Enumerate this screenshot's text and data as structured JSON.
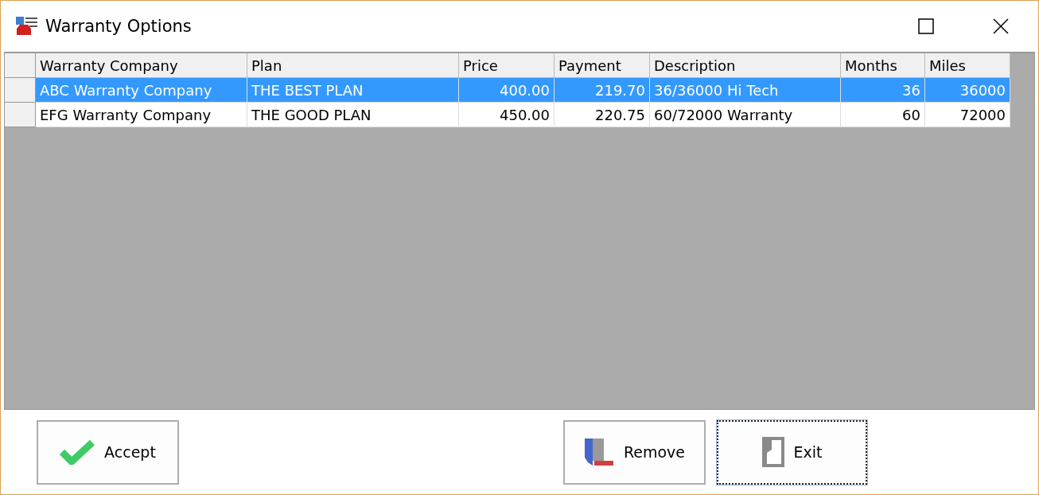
{
  "window": {
    "title": "Warranty Options"
  },
  "table": {
    "columns": [
      {
        "label": "Warranty Company"
      },
      {
        "label": "Plan"
      },
      {
        "label": "Price"
      },
      {
        "label": "Payment"
      },
      {
        "label": "Description"
      },
      {
        "label": "Months"
      },
      {
        "label": "Miles"
      }
    ],
    "rows": [
      {
        "selected": true,
        "cells": [
          "ABC Warranty Company",
          "THE BEST PLAN",
          "400.00",
          "219.70",
          "36/36000 Hi Tech",
          "36",
          "36000"
        ]
      },
      {
        "selected": false,
        "cells": [
          "EFG Warranty Company",
          "THE GOOD PLAN",
          "450.00",
          "220.75",
          "60/72000 Warranty",
          "60",
          "72000"
        ]
      }
    ]
  },
  "buttons": [
    {
      "kind": "accept",
      "label": "Accept",
      "focused": false
    },
    {
      "kind": "remove",
      "label": "Remove",
      "focused": false
    },
    {
      "kind": "exit",
      "label": "Exit",
      "focused": true
    }
  ]
}
